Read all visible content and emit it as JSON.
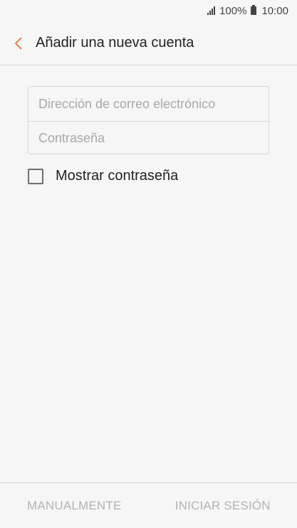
{
  "status_bar": {
    "battery": "100%",
    "time": "10:00",
    "icons": [
      "signal-icon",
      "battery-icon"
    ]
  },
  "app_bar": {
    "back_icon": "chevron-left-icon",
    "title": "Añadir una nueva cuenta",
    "accent_color": "#e8834a"
  },
  "form": {
    "email_placeholder": "Dirección de correo electrónico",
    "email_value": "",
    "password_placeholder": "Contraseña",
    "password_value": ""
  },
  "show_password": {
    "label": "Mostrar contraseña",
    "checked": false
  },
  "bottom_bar": {
    "manual_label": "MANUALMENTE",
    "sign_in_label": "INICIAR SESIÓN",
    "disabled_color": "#b3b3b3"
  }
}
